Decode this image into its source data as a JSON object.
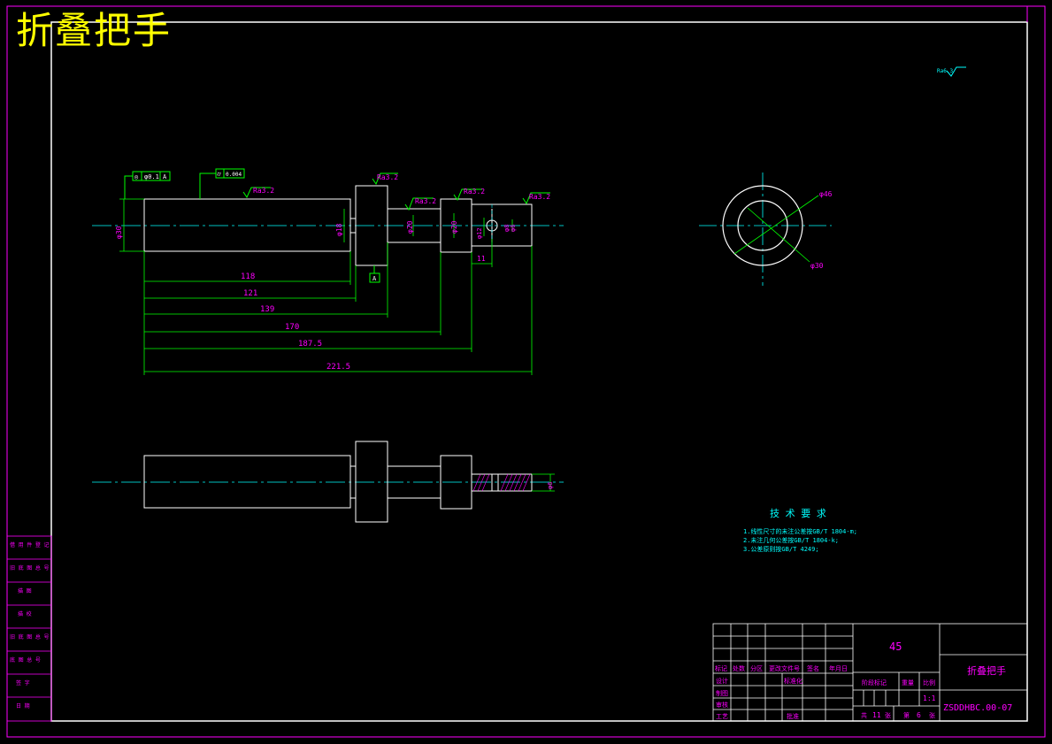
{
  "watermark": "折叠把手",
  "roughness_note": "Ra6.3",
  "top_symbols": {
    "concentricity": "◎",
    "concentricity_value": "φ0.1",
    "concentricity_datum": "A",
    "cylindricity": "⌭",
    "cylindricity_value": "0.004"
  },
  "roughness": [
    "Ra3.2",
    "Ra3.2",
    "Ra3.2",
    "Ra3.2",
    "Ra3.2"
  ],
  "datum_label": "A",
  "diameters": {
    "d1": "φ30",
    "d2": "φ18",
    "d3": "φ20",
    "d4": "φ20",
    "d5": "φ12",
    "d6": "φ8",
    "d7": "φ6",
    "section_outer": "φ46",
    "section_inner": "φ30",
    "bottom_hole": "φ6"
  },
  "small_dim": "11",
  "lengths": [
    "118",
    "121",
    "139",
    "170",
    "187.5",
    "221.5"
  ],
  "tech_req": {
    "title": "技 术 要 求",
    "items": [
      "1.线性尺寸的未注公差按GB/T 1804-m;",
      "2.未注几何公差按GB/T 1804-k;",
      "3.公差原则按GB/T 4249;"
    ]
  },
  "left_strip": [
    "借 用 件 登 记",
    "旧 底 图 总 号",
    "描 图",
    "描 校",
    "旧 底 图 总 号",
    "底 图 总 号",
    "签 字",
    "日 期"
  ],
  "title_block": {
    "material": "45",
    "part_name": "折叠把手",
    "drawing_no": "ZSDDHBC.00-07",
    "scale": "1:1",
    "header_cells": [
      "标记",
      "处数",
      "分区",
      "更改文件号",
      "签名",
      "年月日"
    ],
    "row_labels": [
      "设计",
      "制图",
      "审核",
      "工艺"
    ],
    "standardization": "标准化",
    "approve": "批准",
    "stage_mark": "阶段标记",
    "weight": "重量",
    "ratio": "比例",
    "sheet_total_prefix": "共",
    "sheet_total": "11",
    "sheet_unit": "张",
    "sheet_no_prefix": "第",
    "sheet_no": "6",
    "sheet_no_unit": "张"
  }
}
